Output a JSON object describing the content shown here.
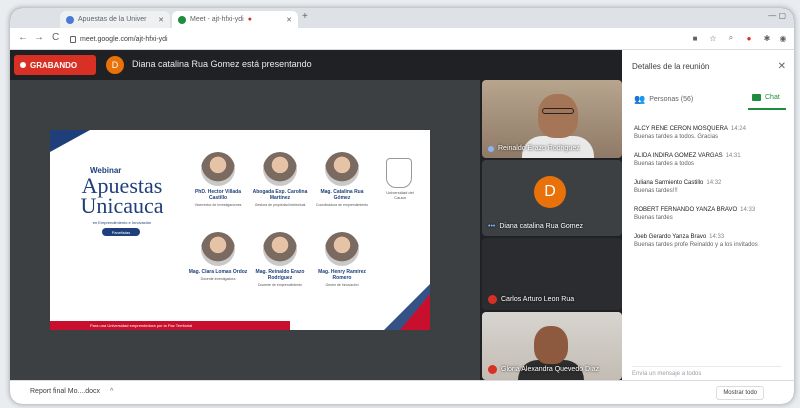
{
  "browser": {
    "tabs": [
      {
        "label": "Apuestas de la Univer",
        "close": "✕"
      },
      {
        "label": "Meet - ajt-hfxi-ydi",
        "close": "✕",
        "rec": "●"
      }
    ],
    "new_tab": "+",
    "url": "meet.google.com/ajt-hfxi-ydi",
    "nav": {
      "back": "←",
      "forward": "→",
      "reload": "C"
    }
  },
  "meet": {
    "recording_label": "GRABANDO",
    "presenter_initial": "D",
    "presenting_text": "Diana catalina Rua Gomez está presentando"
  },
  "slide": {
    "title_small": "Webinar",
    "title_big": "Apuestas Unicauca",
    "subtitle": "en Emprendimiento e Innovación",
    "pill": "Panelistas",
    "crest_label": "Universidad del Cauca",
    "footer": "Para una Universidad emprendedora por la Paz Territorial",
    "speakers": [
      {
        "name": "PhD. Hector Villada Castillo",
        "desc": "Vicerrector de Investigaciones"
      },
      {
        "name": "Abogada Exp. Carolina Martínez",
        "desc": "Gestora de propiedad intelectual"
      },
      {
        "name": "Mag. Catalina Rua Gómez",
        "desc": "Coordinadora de emprendimiento"
      },
      {
        "name": "Mag. Clara Lomas Ordoz",
        "desc": "Docente investigadora"
      },
      {
        "name": "Mag. Reinaldo Erazo Rodríguez",
        "desc": "Docente de emprendimiento"
      },
      {
        "name": "Mag. Henry Ramírez Romero",
        "desc": "Gestor de innovación"
      }
    ]
  },
  "participants": [
    {
      "name": "Reinaldo Erazo Rodriguez"
    },
    {
      "name": "Diana catalina Rua Gomez",
      "initial": "D"
    },
    {
      "name": "Carlos Arturo Leon Rua"
    },
    {
      "name": "Gloria Alexandra Quevedo Diaz"
    }
  ],
  "panel": {
    "title": "Detalles de la reunión",
    "close": "✕",
    "people_tab": "Personas (56)",
    "chat_tab": "Chat",
    "messages": [
      {
        "sender": "ALCY RENE CERON MOSQUERA",
        "time": "14:24",
        "text": "Buenas tardes a todos. Gracias"
      },
      {
        "sender": "ALIDA INDIRA GOMEZ VARGAS",
        "time": "14:31",
        "text": "Buenas tardes a todos"
      },
      {
        "sender": "Juliana Sarmiento Castillo",
        "time": "14:32",
        "text": "Buenas tardes!!!"
      },
      {
        "sender": "ROBERT FERNANDO YANZA BRAVO",
        "time": "14:33",
        "text": "Buenas tardes"
      },
      {
        "sender": "Joeb Gerardo Yanza Bravo",
        "time": "14:33",
        "text": "Buenas tardes profe Reinaldo y a los invitados"
      }
    ],
    "input_placeholder": "Envía un mensaje a todos"
  },
  "downloads": {
    "file": "Report final Mo....docx",
    "show_all": "Mostrar todo"
  },
  "colors": {
    "record": "#d93025",
    "meet_green": "#1e8e3e",
    "avatar_orange": "#e8710a",
    "slide_blue": "#1f3f7a"
  }
}
